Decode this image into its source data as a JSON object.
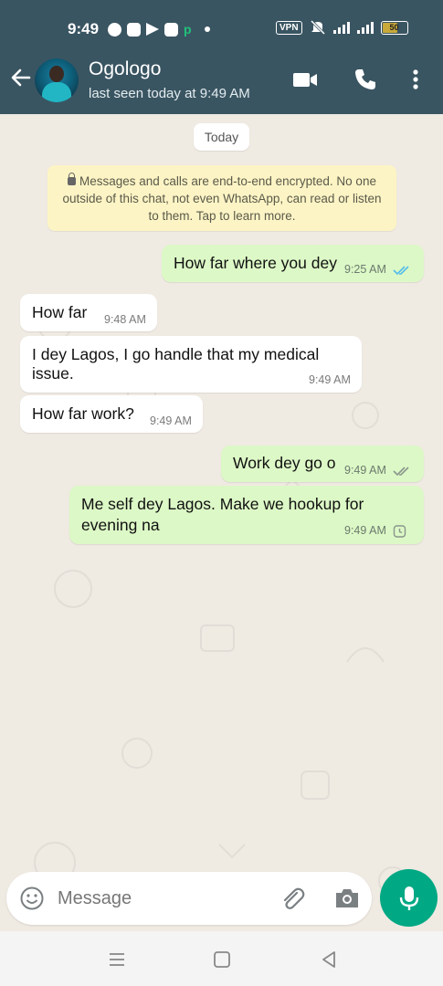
{
  "status_bar": {
    "time": "9:49",
    "vpn": "VPN",
    "battery": "50"
  },
  "header": {
    "contact_name": "Ogologo",
    "last_seen": "last seen today at 9:49 AM"
  },
  "chat": {
    "date_label": "Today",
    "encryption_notice": "Messages and calls are end-to-end encrypted. No one outside of this chat, not even WhatsApp, can read or listen to them. Tap to learn more.",
    "messages": [
      {
        "direction": "outgoing",
        "text": "How far where you dey",
        "time": "9:25 AM",
        "status": "read"
      },
      {
        "direction": "incoming",
        "text": "How far",
        "time": "9:48 AM"
      },
      {
        "direction": "incoming",
        "text": "I dey Lagos, I go handle that my medical issue.",
        "time": "9:49 AM"
      },
      {
        "direction": "incoming",
        "text": "How far work?",
        "time": "9:49 AM"
      },
      {
        "direction": "outgoing",
        "text": "Work dey go o",
        "time": "9:49 AM",
        "status": "delivered"
      },
      {
        "direction": "outgoing",
        "text": "Me self dey Lagos.  Make we hookup for evening na",
        "time": "9:49 AM",
        "status": "pending"
      }
    ]
  },
  "composer": {
    "placeholder": "Message"
  },
  "colors": {
    "header_bg": "#3a5562",
    "chat_bg": "#efeae2",
    "outgoing_bubble": "#dcf8c6",
    "incoming_bubble": "#ffffff",
    "accent": "#00a884",
    "read_tick": "#53bdeb"
  },
  "icons": [
    "back-arrow-icon",
    "video-call-icon",
    "phone-icon",
    "more-vert-icon",
    "lock-icon",
    "emoji-icon",
    "attach-icon",
    "camera-icon",
    "mic-icon",
    "nav-menu-icon",
    "nav-home-icon",
    "nav-back-icon"
  ]
}
